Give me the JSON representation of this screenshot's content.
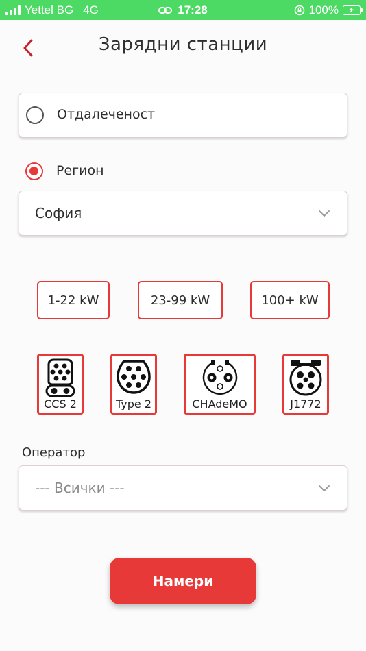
{
  "status_bar": {
    "carrier": "Yettel BG",
    "network": "4G",
    "time": "17:28",
    "battery": "100%",
    "bar_color": "#4cd964"
  },
  "header": {
    "title": "Зарядни станции",
    "back_icon": "chevron-left-icon"
  },
  "location_mode": {
    "distance_label": "Отдалеченост",
    "distance_selected": false,
    "region_label": "Регион",
    "region_selected": true
  },
  "region_select": {
    "value": "София",
    "chevron_icon": "chevron-down-icon"
  },
  "power_options": [
    {
      "label": "1-22 kW"
    },
    {
      "label": "23-99 kW"
    },
    {
      "label": "100+ kW"
    }
  ],
  "connectors": [
    {
      "label": "CCS 2",
      "icon": "ccs2-connector-icon"
    },
    {
      "label": "Type 2",
      "icon": "type2-connector-icon"
    },
    {
      "label": "CHAdeMO",
      "icon": "chademo-connector-icon"
    },
    {
      "label": "J1772",
      "icon": "j1772-connector-icon"
    }
  ],
  "operator": {
    "label": "Оператор",
    "value": "--- Всички ---"
  },
  "search_button": {
    "label": "Намери"
  },
  "colors": {
    "accent": "#e83939",
    "text": "#2e2e2e",
    "background": "#fcfbfb"
  }
}
